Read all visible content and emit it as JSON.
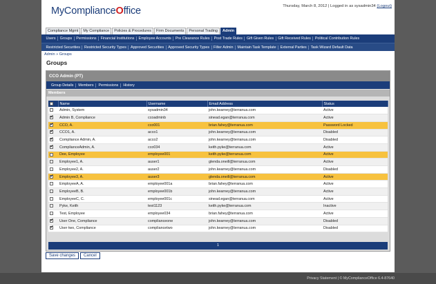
{
  "header": {
    "logo_text_a": "MyCompliance",
    "logo_text_b": "O",
    "logo_text_c": "ffice",
    "datetime": "Thursday, March 8, 2012 | Logged in as sysadmin34",
    "logout_label": "(Logout)"
  },
  "top_tabs": [
    "Compliance Mgmt",
    "My Compliance",
    "Policies & Procedures",
    "Firm Documents",
    "Personal Trading",
    "Admin"
  ],
  "nav_row1": [
    "Users",
    "Groups",
    "Permissions",
    "Financial Institutions",
    "Employee Accounts",
    "Pre Clearance Rules",
    "Post Trade Rules",
    "Gift Given Rules",
    "Gift Received Rules",
    "Political Contribution Rules"
  ],
  "nav_row2": [
    "Restricted Securities",
    "Restricted Security Types",
    "Approved Securities",
    "Approved Security Types",
    "Filter Admin",
    "Maintain Task Template",
    "External Parties",
    "Task Wizard Default Data"
  ],
  "breadcrumb": "Admin » Groups",
  "page_title": "Groups",
  "panel": {
    "title": "CCO Admin (PT)",
    "subtabs": [
      "Group Details",
      "Members",
      "Permissions",
      "History"
    ],
    "section_title": "Members"
  },
  "table": {
    "columns": [
      "",
      "Name",
      "Username",
      "Email Address",
      "Status"
    ],
    "rows": [
      {
        "checked": false,
        "name": "Admin, System",
        "username": "sysadmin34",
        "email": "john.kearney@terranua.com",
        "status": "Active",
        "highlight": false
      },
      {
        "checked": true,
        "name": "Admin B, Compliance",
        "username": "ccoadminb",
        "email": "sinead.egan@terranua.com",
        "status": "Active",
        "highlight": false
      },
      {
        "checked": true,
        "name": "CCO, A.",
        "username": "cco001",
        "email": "brian.fahey@terranua.com",
        "status": "Password Locked",
        "highlight": true
      },
      {
        "checked": true,
        "name": "CCO1, A.",
        "username": "acco1",
        "email": "john.kearney@terranua.com",
        "status": "Disabled",
        "highlight": false
      },
      {
        "checked": true,
        "name": "Compliance Admin, A.",
        "username": "acco2",
        "email": "john.kearney@terranua.com",
        "status": "Disabled",
        "highlight": false
      },
      {
        "checked": true,
        "name": "ComplianceAdmin, A.",
        "username": "cco034",
        "email": "keith.pyke@terranua.com",
        "status": "Active",
        "highlight": false
      },
      {
        "checked": false,
        "name": "Dee, Employee",
        "username": "employee001",
        "email": "keith.pyke@terranua.com",
        "status": "Active",
        "highlight": true
      },
      {
        "checked": false,
        "name": "Employee1, A.",
        "username": "auser1",
        "email": "glenda.oneill@terranua.com",
        "status": "Active",
        "highlight": false
      },
      {
        "checked": false,
        "name": "Employee2, A.",
        "username": "auser2",
        "email": "john.kearney@terranua.com",
        "status": "Disabled",
        "highlight": false
      },
      {
        "checked": true,
        "name": "Employee3, A.",
        "username": "auser3",
        "email": "glenda.oneill@terranua.com",
        "status": "Active",
        "highlight": true
      },
      {
        "checked": false,
        "name": "EmployeeA, A.",
        "username": "employee001a",
        "email": "brian.fahey@terranua.com",
        "status": "Active",
        "highlight": false
      },
      {
        "checked": false,
        "name": "EmployeeB, B.",
        "username": "employee001b",
        "email": "john.kearney@terranua.com",
        "status": "Active",
        "highlight": false
      },
      {
        "checked": false,
        "name": "EmployeeC, C.",
        "username": "employee001c",
        "email": "sinead.egan@terranua.com",
        "status": "Active",
        "highlight": false
      },
      {
        "checked": false,
        "name": "Pyke, Keith",
        "username": "test1123",
        "email": "keith.pyke@terranua.com",
        "status": "Inactive",
        "highlight": false
      },
      {
        "checked": false,
        "name": "Test, Employee",
        "username": "employee034",
        "email": "brian.fahey@terranua.com",
        "status": "Active",
        "highlight": false
      },
      {
        "checked": true,
        "name": "User One, Compliance",
        "username": "complianceone",
        "email": "john.kearney@terranua.com",
        "status": "Disabled",
        "highlight": false
      },
      {
        "checked": true,
        "name": "User two, Compliance",
        "username": "compliancetwo",
        "email": "john.kearney@terranua.com",
        "status": "Disabled",
        "highlight": false
      }
    ],
    "pager": "1"
  },
  "buttons": {
    "save": "Save changes",
    "cancel": "Cancel"
  },
  "footer": "Privacy Statement  |  © MyComplianceOffice 6.4-87640",
  "colors": {
    "navy": "#1b3d7a",
    "highlight": "#f7c23f",
    "logo_red": "#d02020"
  }
}
